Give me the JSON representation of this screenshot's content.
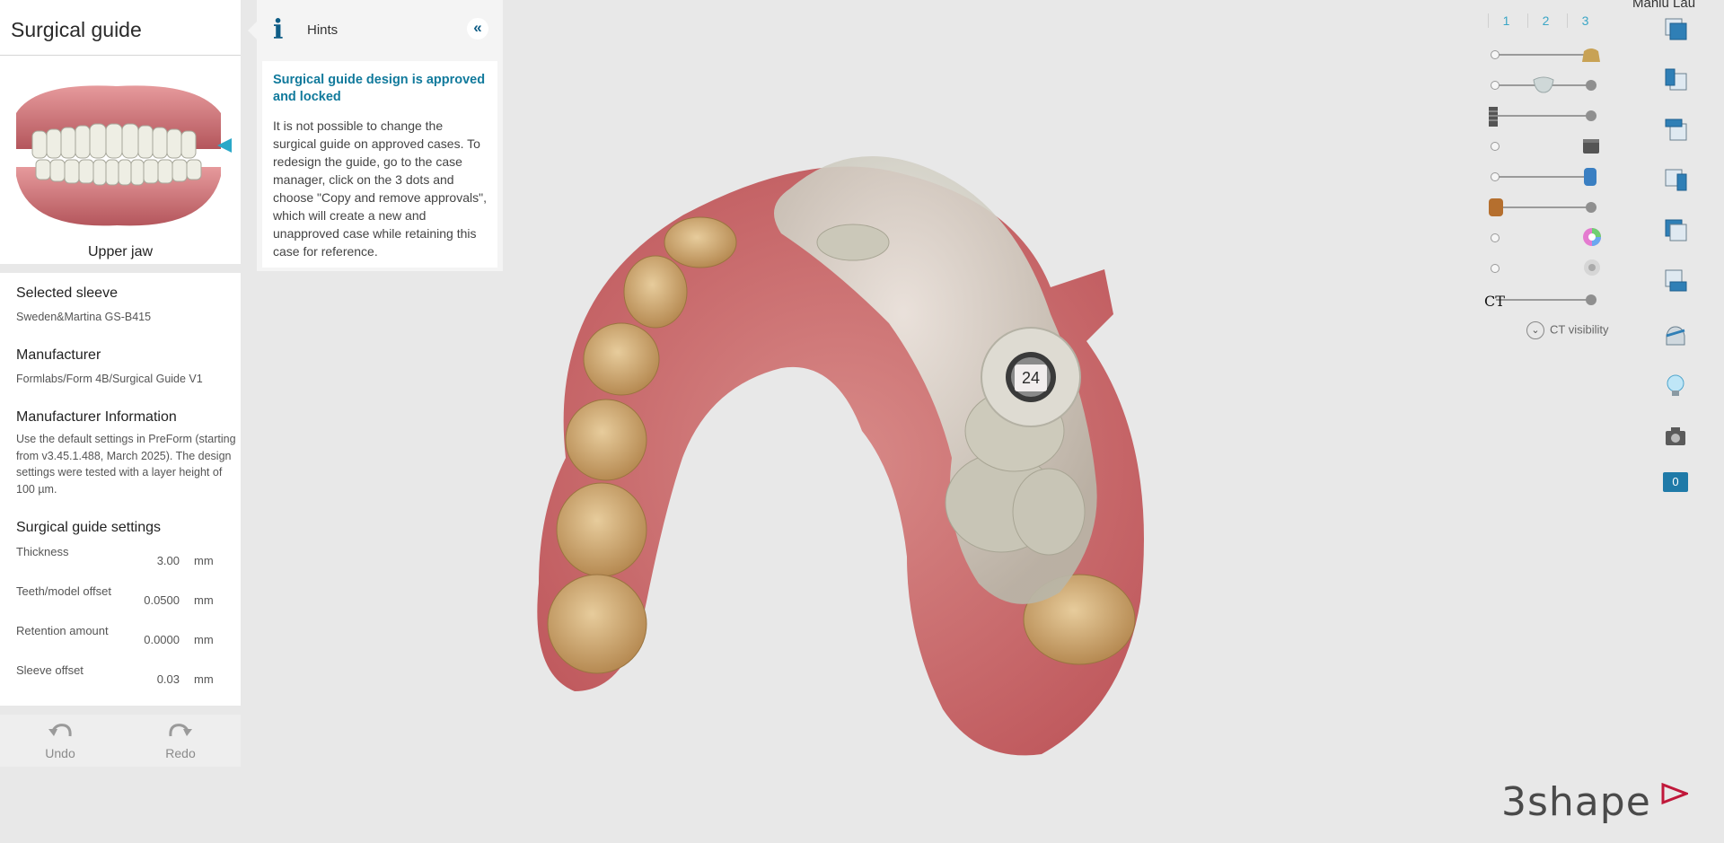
{
  "header": {
    "title": "Surgical guide"
  },
  "jaw": {
    "label": "Upper jaw"
  },
  "sleeve": {
    "heading": "Selected sleeve",
    "value": "Sweden&Martina GS-B415"
  },
  "manufacturer": {
    "heading": "Manufacturer",
    "value": "Formlabs/Form 4B/Surgical Guide V1"
  },
  "manufacturer_info": {
    "heading": "Manufacturer Information",
    "text": "Use the default settings in PreForm (starting from v3.45.1.488, March 2025). The design settings were tested with a layer height of 100 µm."
  },
  "settings": {
    "heading": "Surgical guide settings",
    "items": [
      {
        "label": "Thickness",
        "value": "3.00",
        "unit": "mm"
      },
      {
        "label": "Teeth/model offset",
        "value": "0.0500",
        "unit": "mm"
      },
      {
        "label": "Retention amount",
        "value": "0.0000",
        "unit": "mm"
      },
      {
        "label": "Sleeve offset",
        "value": "0.03",
        "unit": "mm"
      }
    ]
  },
  "actions": {
    "undo": "Undo",
    "redo": "Redo"
  },
  "hints": {
    "title": "Hints",
    "collapse": "«",
    "message_title": "Surgical guide design is approved and locked",
    "message_text": "It is not possible to change the surgical guide on approved cases. To redesign the guide, go to the case manager, click on the 3 dots and choose \"Copy and remove approvals\", which will create a new and unapproved case while retaining this case for reference."
  },
  "viewport": {
    "tooth_number": "24"
  },
  "user": {
    "name": "Manlu Lau"
  },
  "tabs": [
    "1",
    "2",
    "3"
  ],
  "visibility": {
    "ct_label": "CT",
    "ct_visibility": "CT visibility",
    "sliders": [
      {
        "name": "crown-model",
        "level": 1.0
      },
      {
        "name": "tooth-model",
        "level": 0.5
      },
      {
        "name": "implant",
        "level": 1.0
      },
      {
        "name": "sleeve",
        "level": 0
      },
      {
        "name": "guide-cylinder",
        "level": 1.0
      },
      {
        "name": "model-base",
        "level": 1.0
      },
      {
        "name": "color-texture",
        "level": 0
      },
      {
        "name": "scan-visibility",
        "level": 0
      },
      {
        "name": "ct",
        "level": 1.0
      }
    ]
  },
  "side_toolbar": {
    "comment_count": "0",
    "icons": [
      "view-front-icon",
      "view-left-icon",
      "view-top-icon",
      "view-right-icon",
      "view-back-icon",
      "view-bottom-icon",
      "clipping-icon",
      "light-icon",
      "camera-icon",
      "comments-icon"
    ]
  },
  "brand": {
    "name": "3shape"
  },
  "colors": {
    "accent": "#117a9c",
    "link_blue": "#3aa6c6",
    "gum": "#c96a6e",
    "teeth": "#c9a56d",
    "guide": "#d9d7cc"
  }
}
